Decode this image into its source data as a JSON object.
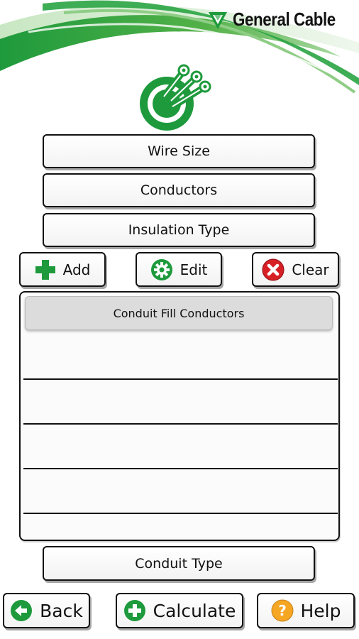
{
  "header": {
    "brand_name": "General Cable"
  },
  "fields": {
    "wire_size_label": "Wire Size",
    "conductors_label": "Conductors",
    "insulation_type_label": "Insulation Type",
    "conduit_type_label": "Conduit Type"
  },
  "actions": {
    "add_label": "Add",
    "edit_label": "Edit",
    "clear_label": "Clear"
  },
  "list": {
    "header": "Conduit Fill Conductors",
    "rows": [
      "",
      "",
      "",
      ""
    ]
  },
  "footer": {
    "back_label": "Back",
    "calculate_label": "Calculate",
    "help_label": "Help"
  },
  "colors": {
    "brand_green": "#1e9a3c",
    "light_green": "#7cc576",
    "clear_red": "#d71f26",
    "help_orange": "#f5a623"
  }
}
